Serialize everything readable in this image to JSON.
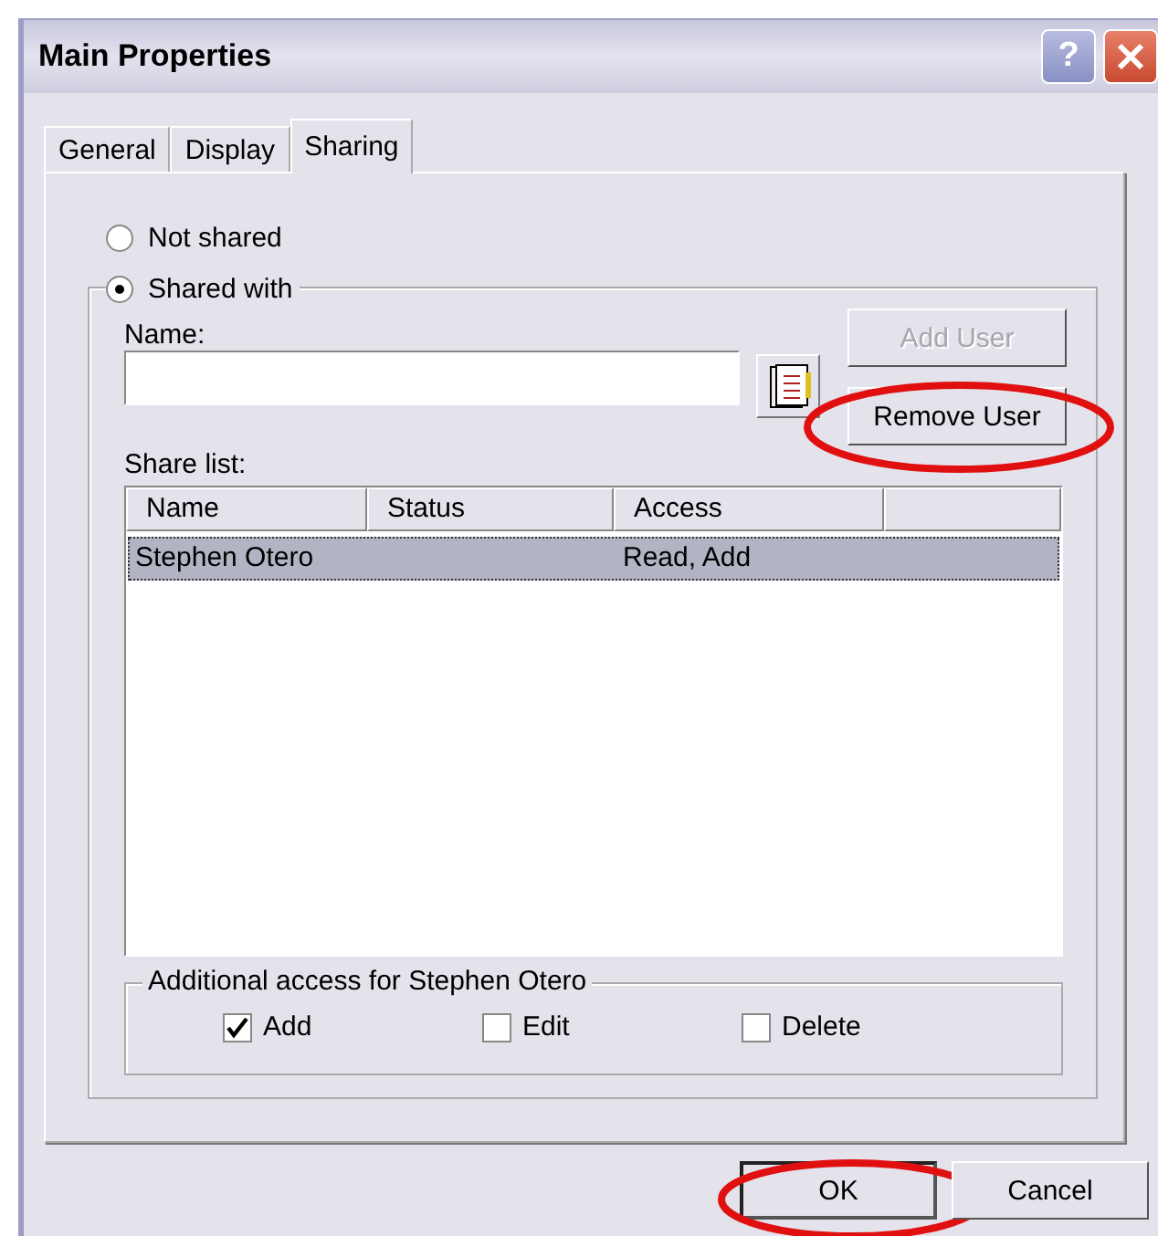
{
  "window": {
    "title": "Main Properties",
    "help_glyph": "?"
  },
  "tabs": [
    {
      "label": "General",
      "selected": false
    },
    {
      "label": "Display",
      "selected": false
    },
    {
      "label": "Sharing",
      "selected": true
    }
  ],
  "sharing_options": [
    {
      "label": "Not shared",
      "selected": false
    },
    {
      "label": "Shared with",
      "selected": true
    }
  ],
  "name_field": {
    "label": "Name:"
  },
  "user_buttons": [
    {
      "label": "Add User",
      "disabled": true,
      "highlighted": false
    },
    {
      "label": "Remove User",
      "disabled": false,
      "highlighted": true
    }
  ],
  "share_list": {
    "label": "Share list:",
    "columns": [
      "Name",
      "Status",
      "Access"
    ],
    "rows": [
      {
        "cells": [
          "Stephen Otero",
          "",
          "Read, Add"
        ],
        "selected": true
      }
    ]
  },
  "additional_access": {
    "title": "Additional access for Stephen Otero",
    "options": [
      {
        "label": "Add",
        "checked": true
      },
      {
        "label": "Edit",
        "checked": false
      },
      {
        "label": "Delete",
        "checked": false
      }
    ]
  },
  "buttons": [
    {
      "label": "OK",
      "highlighted": true
    },
    {
      "label": "Cancel",
      "highlighted": false
    }
  ]
}
